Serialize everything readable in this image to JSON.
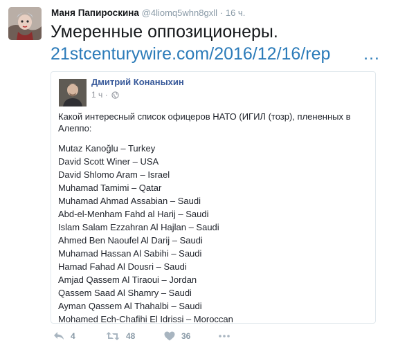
{
  "tweet": {
    "author_name": "Маня Папироскина",
    "author_handle": "@4liomq5whn8gxll",
    "dot": "·",
    "time": "16 ч.",
    "text_line1": "Умеренные оппозиционеры.",
    "link": "21stcenturywire.com/2016/12/16/rep",
    "ellipsis": "…"
  },
  "card": {
    "author_name": "Дмитрий Конаныхин",
    "time": "1 ч",
    "dot": "·",
    "intro": "Какой интересный список офицеров НАТО (ИГИЛ (тозр), плененных в Алеппо:",
    "list": [
      "Mutaz Kanoğlu – Turkey",
      "David Scott Winer – USA",
      "David Shlomo Aram – Israel",
      "Muhamad Tamimi – Qatar",
      "Muhamad Ahmad Assabian – Saudi",
      "Abd-el-Menham Fahd al Harij – Saudi",
      "Islam Salam Ezzahran Al Hajlan – Saudi",
      "Ahmed Ben Naoufel Al Darij – Saudi",
      "Muhamad Hassan Al Sabihi – Saudi",
      "Hamad Fahad Al Dousri – Saudi",
      "Amjad Qassem Al Tiraoui – Jordan",
      "Qassem Saad Al Shamry – Saudi",
      "Ayman Qassem Al Thahalbi – Saudi",
      "Mohamed Ech-Chafihi El Idrissi – Moroccan"
    ]
  },
  "actions": {
    "reply_count": "4",
    "retweet_count": "48",
    "like_count": "36"
  },
  "colors": {
    "link": "#2b7bb9",
    "muted": "#8899a6",
    "fb_blue": "#365899"
  }
}
